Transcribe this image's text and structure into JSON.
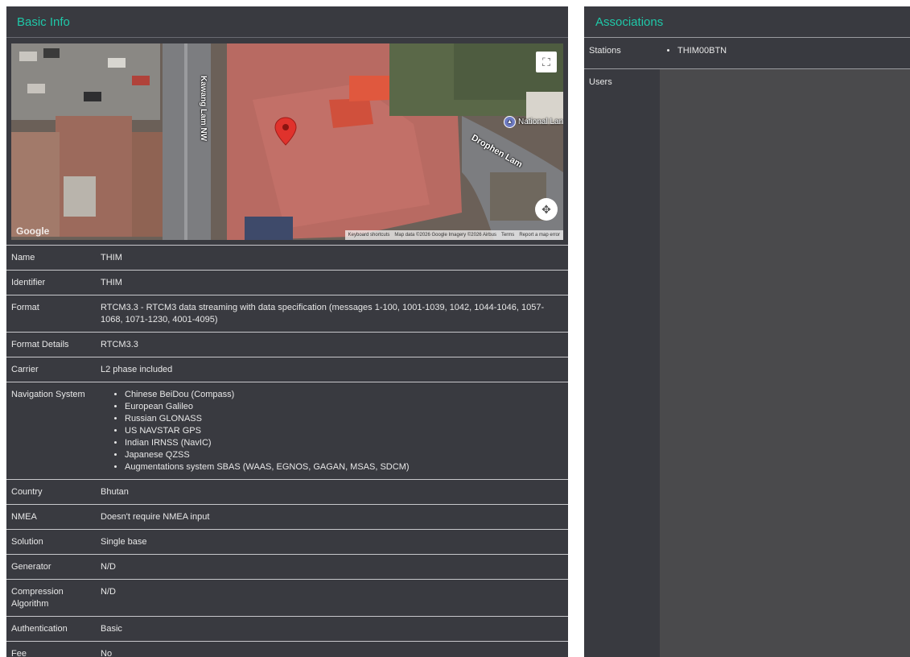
{
  "basic_info": {
    "title": "Basic Info",
    "map": {
      "streets": [
        "Kawang Lam NW",
        "Drophen Lam"
      ],
      "poi": "National Lan",
      "logo": "Google",
      "attribution": [
        "Keyboard shortcuts",
        "Map data ©2026 Google Imagery ©2026 Airbus",
        "Terms",
        "Report a map error"
      ],
      "fullscreen_icon": "fullscreen-icon",
      "pan_icon": "pan-control-icon",
      "marker_color": "#e0322c"
    },
    "rows": [
      {
        "label": "Name",
        "value": "THIM"
      },
      {
        "label": "Identifier",
        "value": "THIM"
      },
      {
        "label": "Format",
        "value": "RTCM3.3 - RTCM3 data streaming with data specification (messages 1-100, 1001-1039, 1042, 1044-1046, 1057-1068, 1071-1230, 4001-4095)"
      },
      {
        "label": "Format Details",
        "value": "RTCM3.3"
      },
      {
        "label": "Carrier",
        "value": "L2 phase included"
      },
      {
        "label": "Navigation System",
        "list": [
          "Chinese BeiDou (Compass)",
          "European Galileo",
          "Russian GLONASS",
          "US NAVSTAR GPS",
          "Indian IRNSS (NavIC)",
          "Japanese QZSS",
          "Augmentations system SBAS (WAAS, EGNOS, GAGAN, MSAS, SDCM)"
        ]
      },
      {
        "label": "Country",
        "value": "Bhutan"
      },
      {
        "label": "NMEA",
        "value": "Doesn't require NMEA input"
      },
      {
        "label": "Solution",
        "value": "Single base"
      },
      {
        "label": "Generator",
        "value": "N/D"
      },
      {
        "label": "Compression Algorithm",
        "value": "N/D"
      },
      {
        "label": "Authentication",
        "value": "Basic"
      },
      {
        "label": "Fee",
        "value": "No"
      }
    ]
  },
  "associations": {
    "title": "Associations",
    "stations_label": "Stations",
    "stations": [
      "THIM00BTN"
    ],
    "users_label": "Users"
  },
  "colors": {
    "accent": "#1fc8a8",
    "panel": "#393a40"
  }
}
